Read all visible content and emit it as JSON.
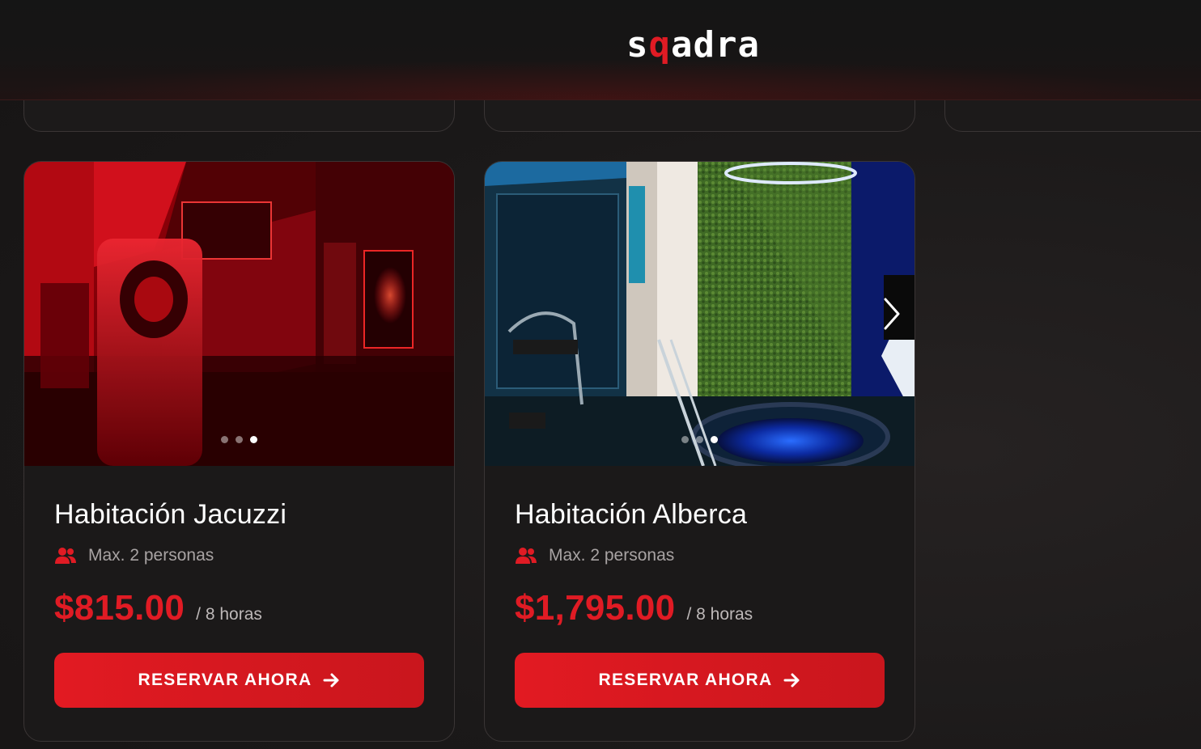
{
  "header": {
    "logo_left": "s",
    "logo_q": "q",
    "logo_right": "adra"
  },
  "rooms": [
    {
      "title": "Habitación Jacuzzi",
      "capacity": "Max. 2 personas",
      "price": "$815.00",
      "per": "/ 8 horas",
      "cta": "RESERVAR AHORA"
    },
    {
      "title": "Habitación Alberca",
      "capacity": "Max. 2 personas",
      "price": "$1,795.00",
      "per": "/ 8 horas",
      "cta": "RESERVAR AHORA"
    }
  ],
  "colors": {
    "accent": "#e01b24",
    "background": "#1a1818",
    "card": "#1b1919"
  },
  "icons": {
    "capacity": "users-icon",
    "cta": "arrow-right-icon",
    "carousel": "chevron-right-icon"
  },
  "carousel": {
    "slides": 3,
    "active_slide": 3
  }
}
